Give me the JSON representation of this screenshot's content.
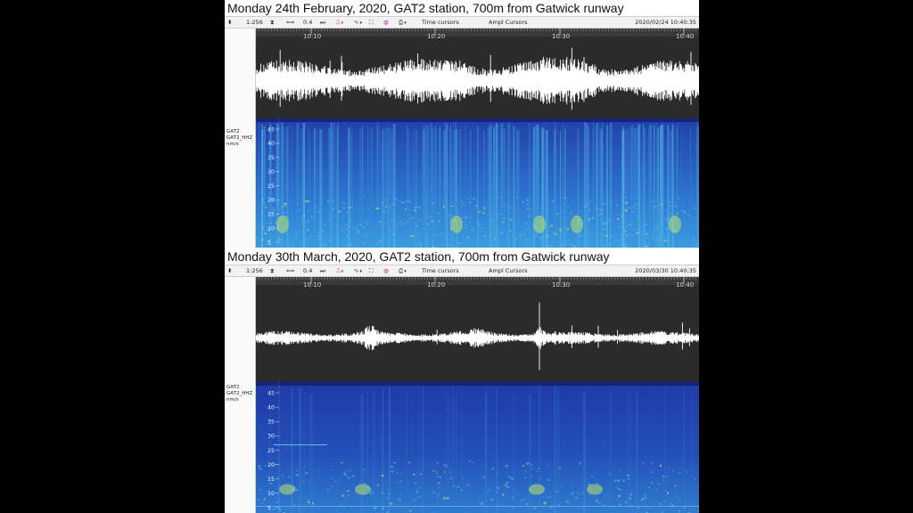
{
  "colors": {
    "background": "#000000",
    "figure_bg": "#ffffff",
    "waveform_bg": "#2b2b2b",
    "waveform_trace": "#ffffff",
    "spectrogram_low": "#1f3fb0",
    "spectrogram_mid": "#2f86d8",
    "spectrogram_high": "#b9e36a",
    "toolbar_bg": "#f2f2f2"
  },
  "panels": [
    {
      "title": "Monday 24th February, 2020, GAT2 station, 700m from Gatwick runway",
      "toolbar": {
        "sort_icon": "up-down-arrows-icon",
        "scale": "1:256",
        "hourglass_icon": "hourglass-icon",
        "pan_icon": "horizontal-arrows-icon",
        "gain": "0.4",
        "jump_icon": "skip-arrows-icon",
        "filter_icon": "filter-pulse-icon",
        "wave_icon": "wave-icon",
        "fit_icon": "expand-icon",
        "color_icon": "color-wheel-icon",
        "print_icon": "printer-icon",
        "time_cursors": "Time cursors",
        "ampl_cursors": "Ampl Cursors",
        "timestamp": "2020/02/24 10:40:35"
      },
      "channel": {
        "station": "GAT2",
        "component": "GAT2_HHZ",
        "unit": "nm/s"
      },
      "time_ticks": [
        "10:10",
        "10:20",
        "10:30",
        "10:40"
      ],
      "freq_ticks": [
        "45",
        "40",
        "35",
        "30",
        "25",
        "20",
        "15",
        "10",
        "5"
      ],
      "activity": "high"
    },
    {
      "title": "Monday 30th March, 2020, GAT2 station, 700m from Gatwick runway",
      "toolbar": {
        "sort_icon": "up-down-arrows-icon",
        "scale": "1:256",
        "hourglass_icon": "hourglass-icon",
        "pan_icon": "horizontal-arrows-icon",
        "gain": "0.4",
        "jump_icon": "skip-arrows-icon",
        "filter_icon": "filter-pulse-icon",
        "wave_icon": "wave-icon",
        "fit_icon": "expand-icon",
        "color_icon": "color-wheel-icon",
        "print_icon": "printer-icon",
        "time_cursors": "Time cursors",
        "ampl_cursors": "Ampl Cursors",
        "timestamp": "2020/03/30 10:40:35"
      },
      "channel": {
        "station": "GAT2",
        "component": "GAT2_HHZ",
        "unit": "nm/s"
      },
      "time_ticks": [
        "10:10",
        "10:20",
        "10:30",
        "10:40"
      ],
      "freq_ticks": [
        "45",
        "40",
        "35",
        "30",
        "25",
        "20",
        "15",
        "10",
        "5"
      ],
      "activity": "low"
    }
  ]
}
